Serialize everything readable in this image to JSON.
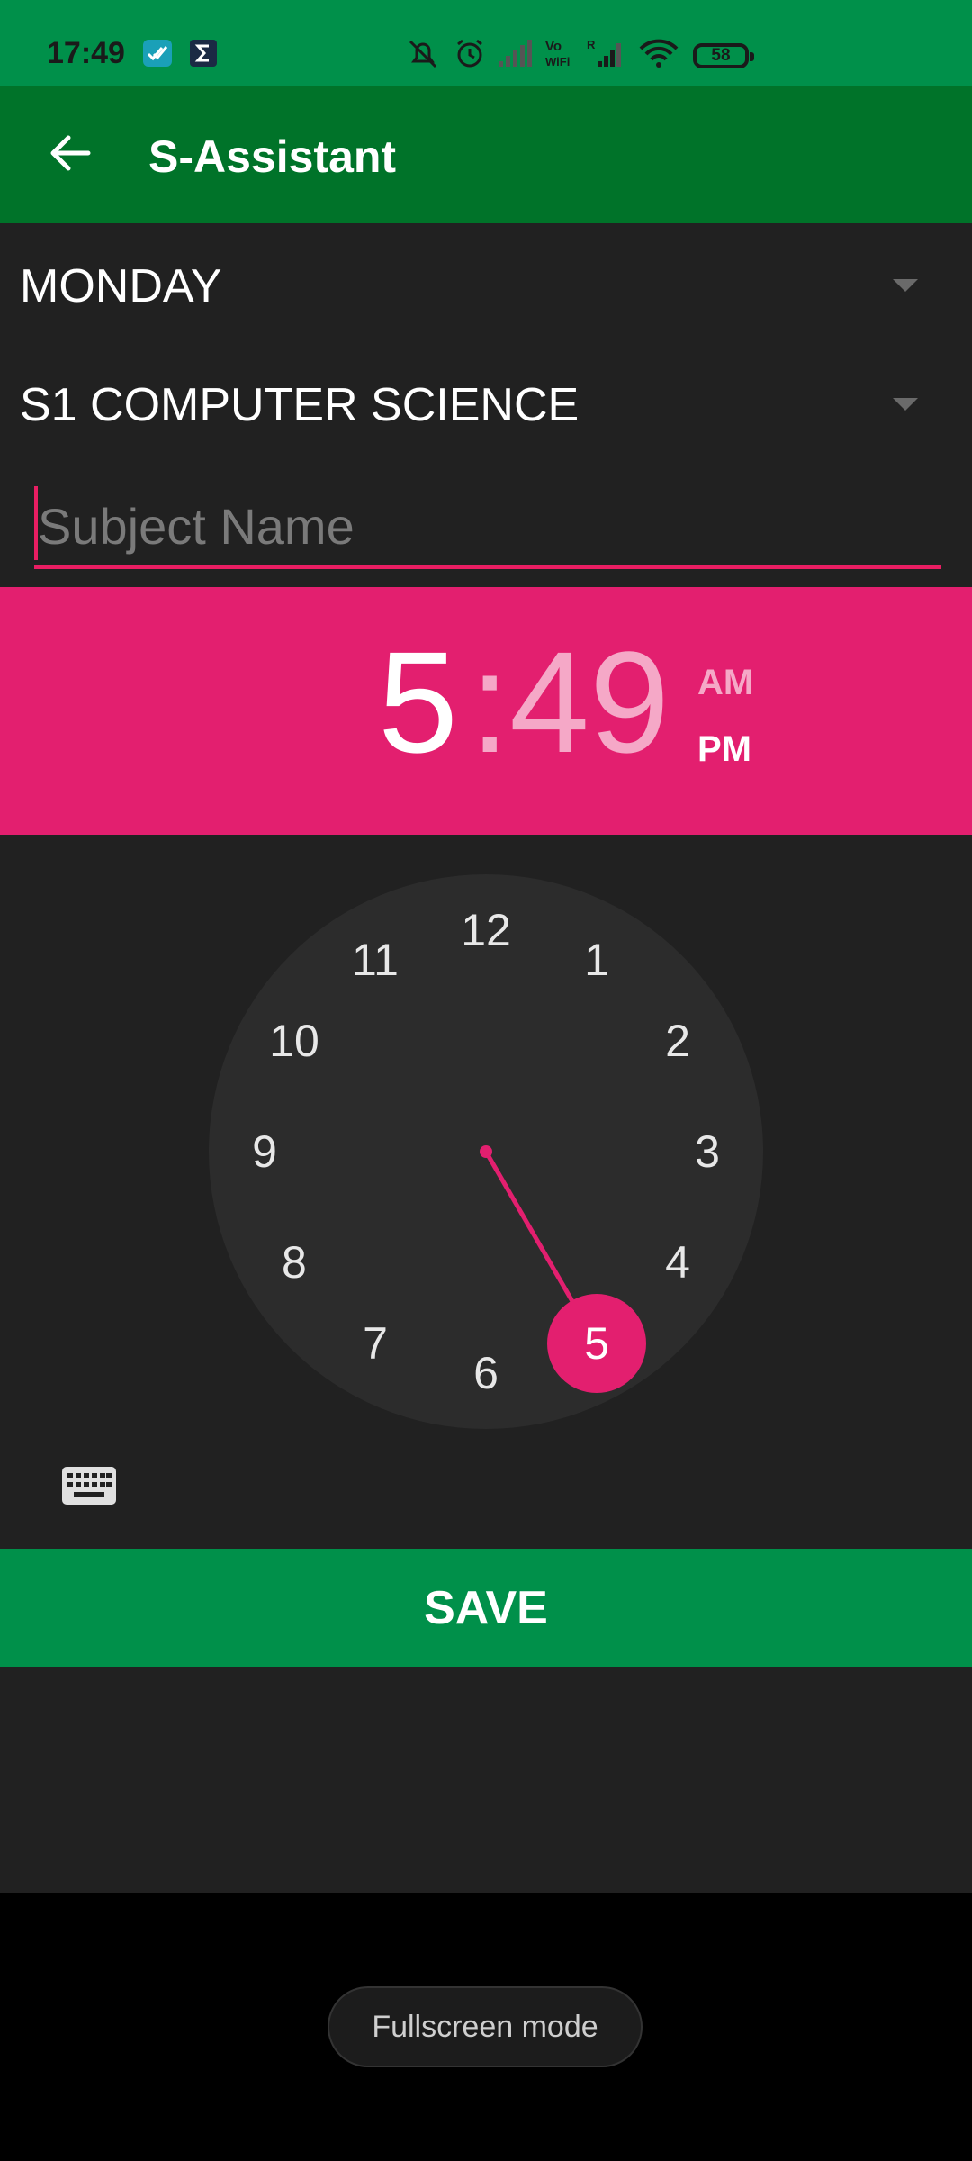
{
  "status_bar": {
    "time": "17:49",
    "battery": "58",
    "icons": [
      "check-badge-icon",
      "sigma-icon",
      "mute-icon",
      "alarm-icon",
      "signal-icon",
      "volte-wifi-icon",
      "signal-roaming-icon",
      "wifi-icon",
      "battery-icon"
    ]
  },
  "app_bar": {
    "title": "S-Assistant",
    "back_icon": "arrow-back-icon",
    "color": "#007329"
  },
  "form": {
    "day": "MONDAY",
    "class": "S1 COMPUTER SCIENCE",
    "subject_placeholder": "Subject Name",
    "subject_value": ""
  },
  "time_picker": {
    "hour": "5",
    "separator": ":",
    "minute": "49",
    "am": "AM",
    "pm": "PM",
    "selected_period": "PM",
    "accent_color": "#e31f6f",
    "dial_numbers": [
      "12",
      "1",
      "2",
      "3",
      "4",
      "5",
      "6",
      "7",
      "8",
      "9",
      "10",
      "11"
    ],
    "selected_number": "5",
    "keyboard_icon": "keyboard-icon"
  },
  "actions": {
    "save": "SAVE"
  },
  "system": {
    "fullscreen_label": "Fullscreen mode"
  }
}
